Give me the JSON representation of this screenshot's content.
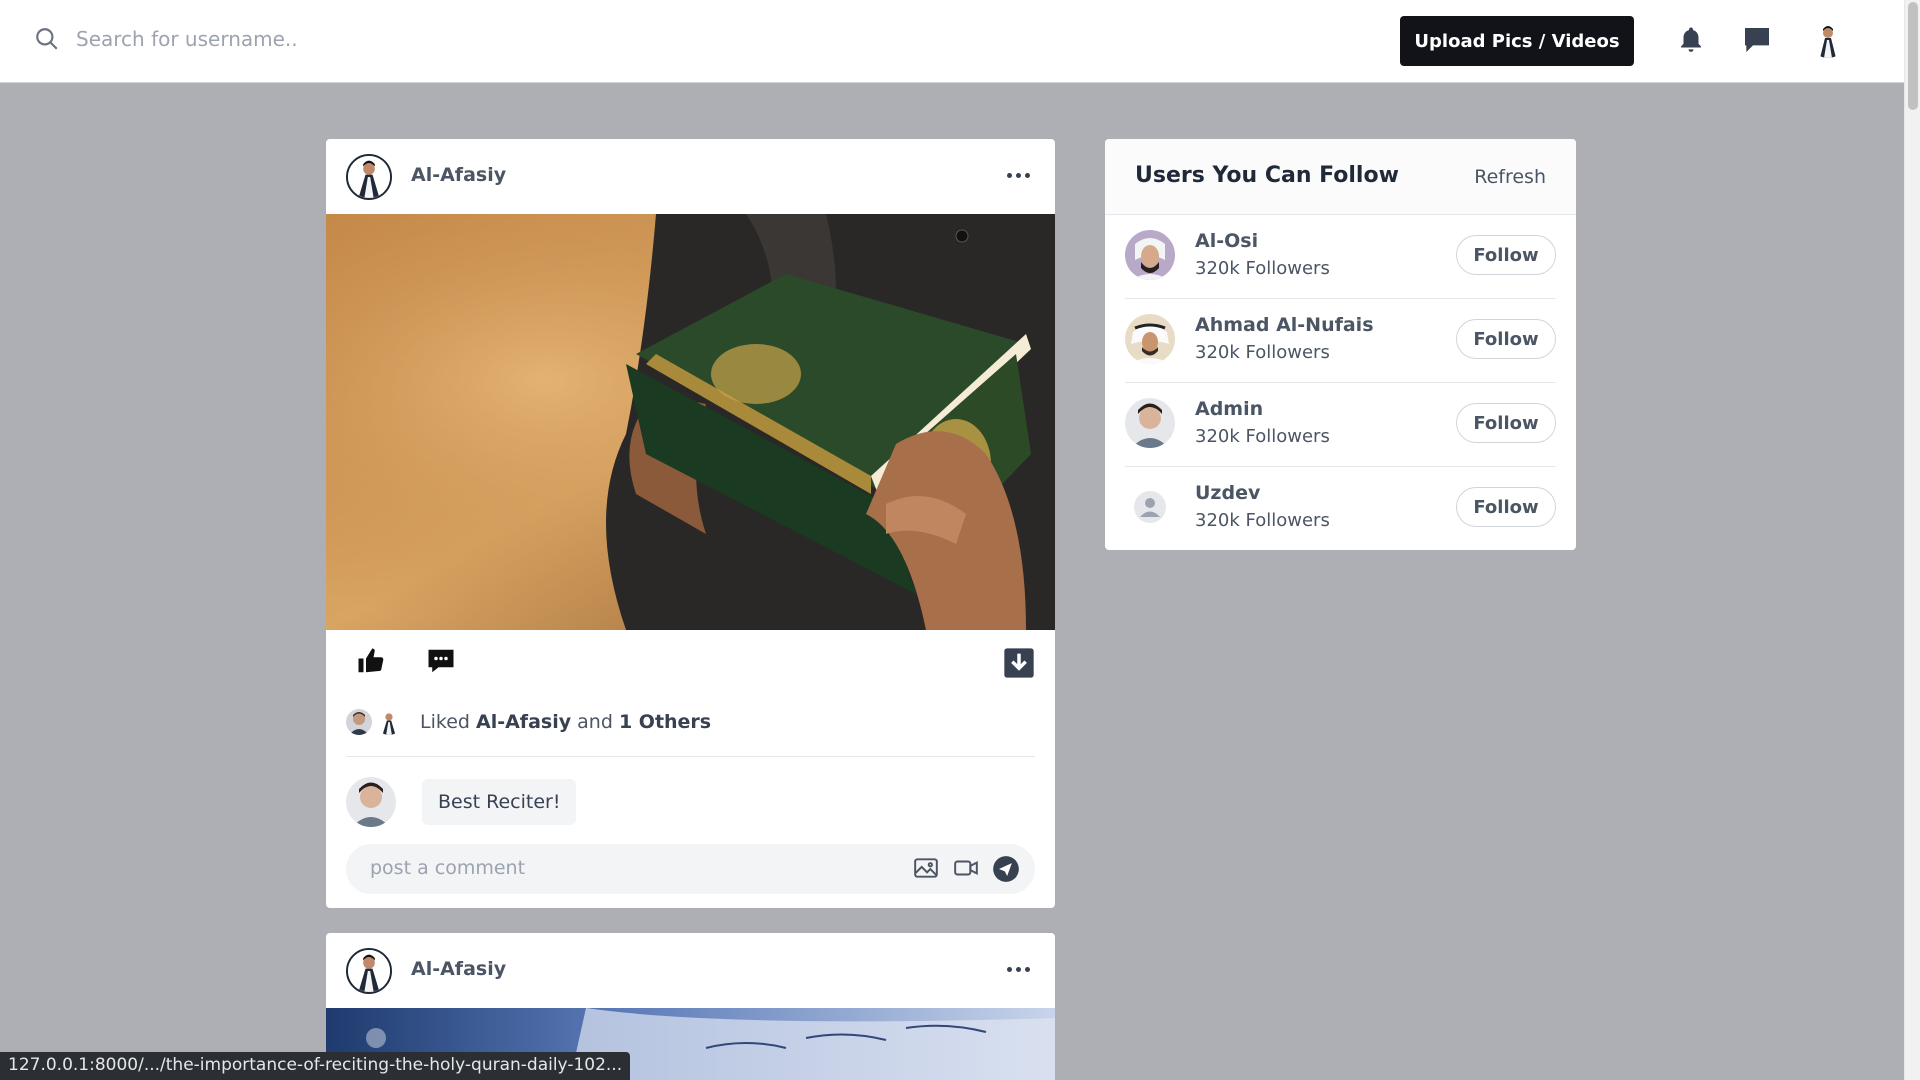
{
  "header": {
    "search_placeholder": "Search for username..",
    "upload_label": "Upload Pics / Videos"
  },
  "posts": [
    {
      "author": "Al-Afasiy",
      "liked_prefix": "Liked",
      "liked_user": "Al-Afasiy",
      "liked_and": "and",
      "liked_others": "1 Others",
      "comments": [
        {
          "text": "Best Reciter!"
        }
      ],
      "comment_placeholder": "post a comment"
    },
    {
      "author": "Al-Afasiy"
    }
  ],
  "suggestions": {
    "title": "Users You Can Follow",
    "refresh_label": "Refresh",
    "users": [
      {
        "name": "Al-Osi",
        "followers": "320k Followers",
        "button": "Follow"
      },
      {
        "name": "Ahmad Al-Nufais",
        "followers": "320k Followers",
        "button": "Follow"
      },
      {
        "name": "Admin",
        "followers": "320k Followers",
        "button": "Follow"
      },
      {
        "name": "Uzdev",
        "followers": "320k Followers",
        "button": "Follow"
      }
    ]
  },
  "status_bar": {
    "url": "127.0.0.1:8000/.../the-importance-of-reciting-the-holy-quran-daily-102..."
  },
  "colors": {
    "page_bg": "#adafb5",
    "primary_button": "#111318"
  }
}
